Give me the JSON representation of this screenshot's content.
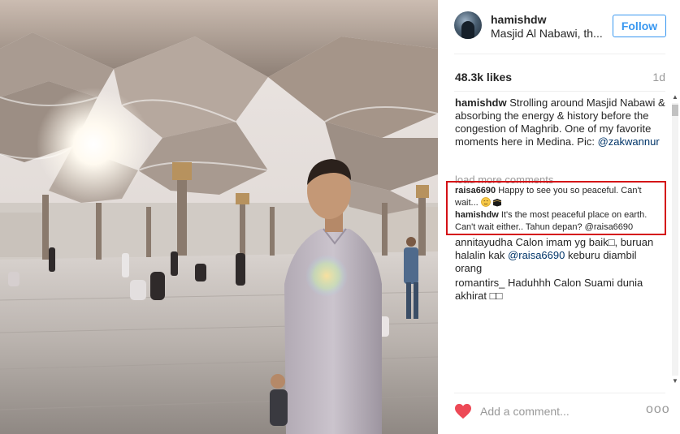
{
  "post": {
    "username": "hamishdw",
    "location": "Masjid Al Nabawi, th...",
    "follow_label": "Follow",
    "likes": "48.3k likes",
    "time_ago": "1d"
  },
  "caption": {
    "username": "hamishdw",
    "text": "Strolling around Masjid Nabawi & absorbing the energy & history before the congestion of Maghrib. One of my favorite moments here in Medina. Pic: ",
    "mention": "@zakwannur"
  },
  "load_more": "load more comments",
  "highlighted": [
    {
      "username": "raisa6690",
      "text": "Happy to see you so peaceful. Can't wait... "
    },
    {
      "username": "hamishdw",
      "text": "It's the most peaceful place on earth. Can't wait either.. Tahun depan? @raisa6690"
    }
  ],
  "comments": [
    {
      "username": "annitayudha",
      "text": "Calon imam yg baik□, buruan halalin kak ",
      "mention": "@raisa6690",
      "text_after": " keburu diambil orang"
    },
    {
      "username": "romantirs_",
      "text": "Haduhhh Calon Suami dunia akhirat □□"
    }
  ],
  "footer": {
    "placeholder": "Add a comment...",
    "more": "ooo"
  },
  "icons": {
    "like": "heart-icon",
    "more": "ellipsis-icon",
    "scroll_up": "triangle-up-icon",
    "scroll_down": "triangle-down-icon"
  },
  "colors": {
    "accent": "#3897f0",
    "heart": "#ed4956",
    "highlight_border": "#d41116",
    "mention": "#003569"
  }
}
